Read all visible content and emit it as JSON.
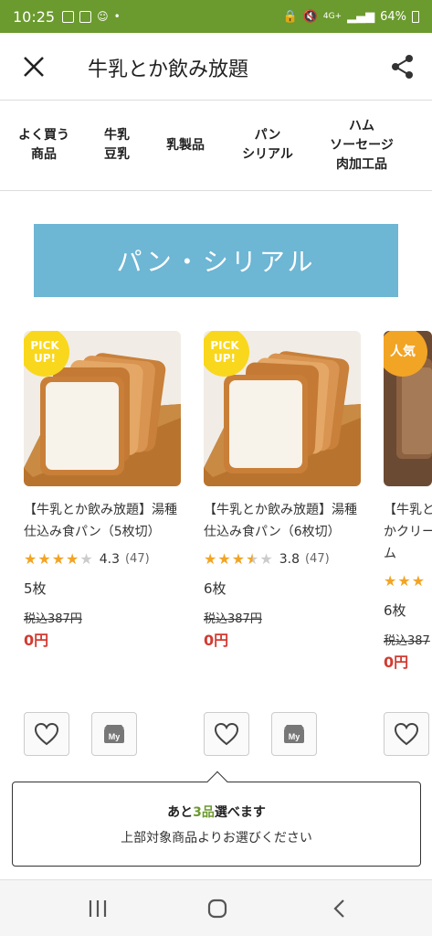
{
  "status_bar": {
    "time": "10:25",
    "network": "4G+",
    "battery": "64%"
  },
  "header": {
    "title": "牛乳とか飲み放題",
    "close_icon": "close-icon",
    "share_icon": "share-icon"
  },
  "categories": [
    "よく買う\n商品",
    "牛乳\n豆乳",
    "乳製品",
    "パン\nシリアル",
    "ハム\nソーセージ\n肉加工品"
  ],
  "banner": {
    "title": "パン・シリアル",
    "color": "#6db6d4"
  },
  "products": [
    {
      "badge": "PICK\nUP!",
      "name": "【牛乳とか飲み放題】湯種仕込み食パン（5枚切）",
      "rating": "4.3",
      "rating_value": 4.3,
      "reviews": "(47)",
      "qty": "5枚",
      "orig_price": "税込387円",
      "price": "0円"
    },
    {
      "badge": "PICK\nUP!",
      "name": "【牛乳とか飲み放題】湯種仕込み食パン（6枚切）",
      "rating": "3.8",
      "rating_value": 3.8,
      "reviews": "(47)",
      "qty": "6枚",
      "orig_price": "税込387円",
      "price": "0円"
    },
    {
      "badge": "人気",
      "name": "【牛乳とかクリーム",
      "qty": "6枚",
      "orig_price": "税込387",
      "price": "0円"
    }
  ],
  "popup": {
    "line1_prefix": "あと",
    "line1_num": "3品",
    "line1_suffix": "選べます",
    "line2": "上部対象商品よりお選びください"
  },
  "colors": {
    "accent_green": "#6b9a2e",
    "price_red": "#d23b32",
    "star": "#f2a425",
    "badge_pickup": "#f9d71c",
    "badge_popular": "#f2a425"
  }
}
